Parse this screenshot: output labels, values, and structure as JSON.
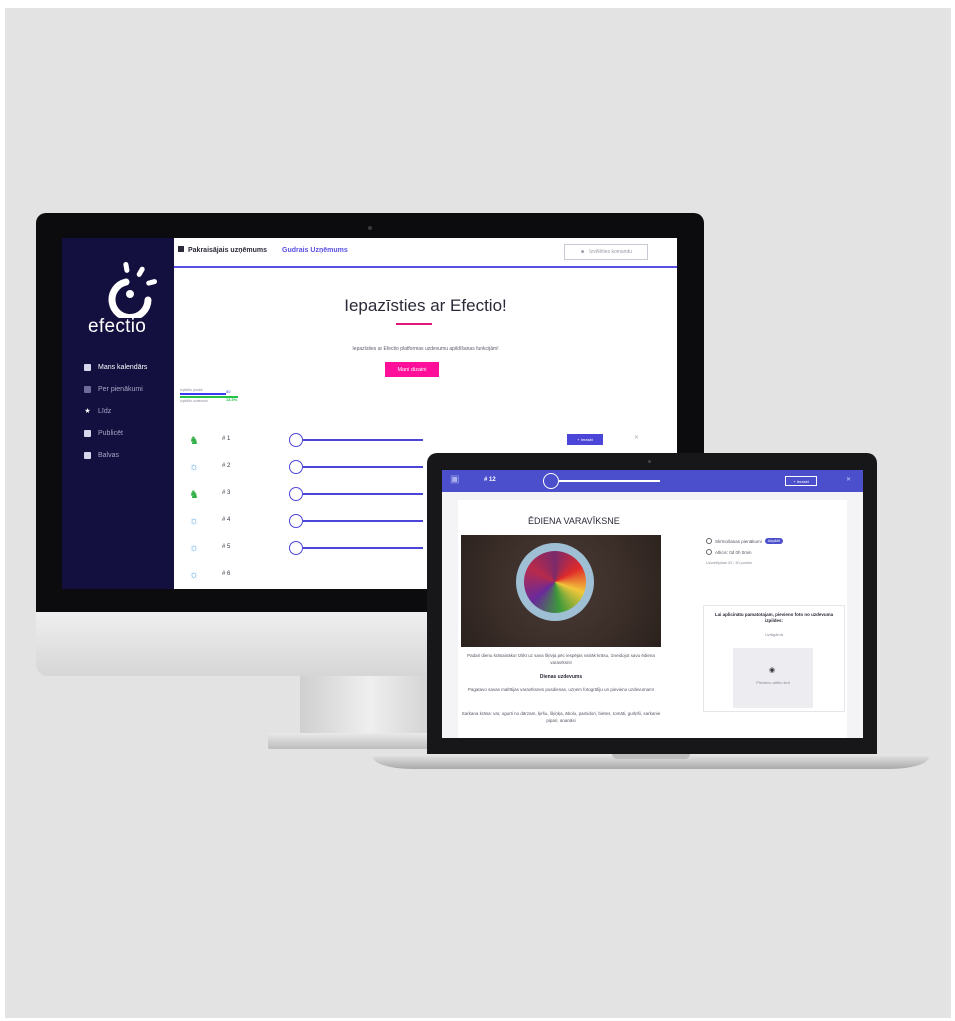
{
  "imac": {
    "logo_text": "efectio",
    "sidebar": {
      "items": [
        {
          "label": "Mans kalendārs",
          "icon": "calendar-icon"
        },
        {
          "label": "Per pienākumi",
          "icon": "list-icon"
        },
        {
          "label": "Līdz",
          "icon": "star-icon"
        },
        {
          "label": "Publicēt",
          "icon": "calendar-icon"
        },
        {
          "label": "Balvas",
          "icon": "gift-icon"
        }
      ]
    },
    "topbar": {
      "tab_primary": "Pakraisājais uzņēmums",
      "tab_secondary": "Gudrais Uzņēmums",
      "right_button": "Izvēlēties komandu"
    },
    "hero": {
      "title": "Iepazīsties ar Efectio!",
      "subtitle": "Iepazīsties ar Efectio platformas uzdevumu apildīšanas funkcijām!",
      "button": "Mani dizaini"
    },
    "stats": {
      "label1": "Izpildīto punkti",
      "value1": "50",
      "label2": "Izpildīto uzdevumi",
      "value2": "13.5%"
    },
    "rows": [
      {
        "num": "# 1",
        "icon": "people-icon",
        "color": "#2fae45",
        "has_button": true,
        "button": "+ Ieraskt"
      },
      {
        "num": "# 2",
        "icon": "trophy-icon",
        "color": "#5aa9e6",
        "has_button": false
      },
      {
        "num": "# 3",
        "icon": "people-icon",
        "color": "#2fae45",
        "has_button": false
      },
      {
        "num": "# 4",
        "icon": "trophy-icon",
        "color": "#5aa9e6",
        "has_button": false
      },
      {
        "num": "# 5",
        "icon": "trophy-icon",
        "color": "#5aa9e6",
        "has_button": false
      },
      {
        "num": "# 6",
        "icon": "trophy-icon",
        "color": "#5aa9e6",
        "has_button": false
      }
    ]
  },
  "laptop": {
    "topbar": {
      "num": "# 12",
      "button": "+ Ieraskt"
    },
    "card": {
      "title": "ĒDIENA VARAVĪKSNE",
      "intro": "Padari dienu krāsaināku! Izlikt uz sava šķīvja pēc iespējas vairāk krāsu, izveidojot savu ēdiena varavīksni!",
      "daily_heading": "Dienas uzdevums",
      "daily_text": "Pagatavo savas maltītijas varavīksnes pusdienas, uzņem fotogrāfiju un pievieno uzdevumam!",
      "red_text": "Sarkana krāsa: var, ogurti no dārzam, ķiršu, šķiņķa, ābolu, pamidori, bietes, tomāti, gurķīši, sarkanie pipari, ananāsi"
    },
    "side": {
      "scoring": "Skrīnošanas pienākumi",
      "badge": "Aizpildīt",
      "remaining": "Atlicis: 0d 0h 0min",
      "limit": "Uzvarējušas 20 / 30 punktu",
      "box_title": "Lai aplicinātu pamatotajam, pievieno foto no uzdevuma izpildes:",
      "box_sub": "Uzlāgāmā",
      "upload_label": "Pievieno attēlu šeit"
    }
  }
}
